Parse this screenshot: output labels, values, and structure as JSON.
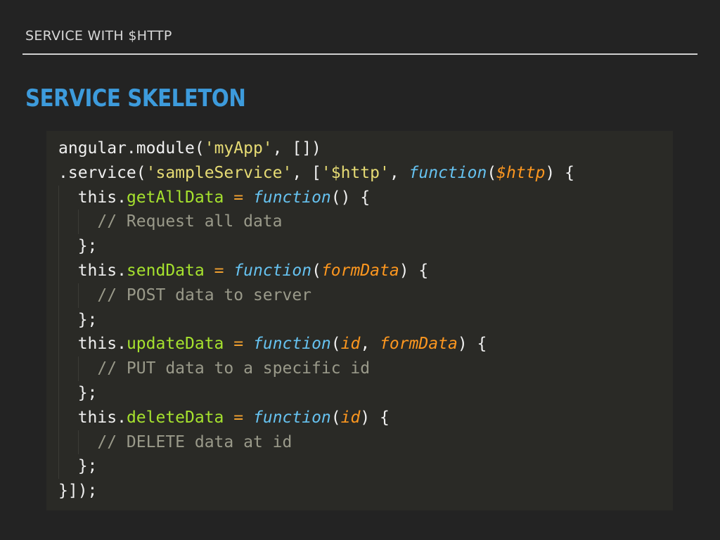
{
  "slide": {
    "header": "SERVICE WITH $HTTP",
    "title": "SERVICE SKELETON"
  },
  "colors": {
    "background": "#232323",
    "title": "#3d9bdc",
    "code_background": "#2a2a26",
    "string": "#e6db74",
    "keyword": "#66c2f0",
    "parameter": "#fd971f",
    "method": "#a6e22e",
    "comment": "#9a9a8a"
  },
  "code": {
    "language": "javascript",
    "lines": [
      [
        [
          "plain",
          "angular.module("
        ],
        [
          "str",
          "'myApp'"
        ],
        [
          "plain",
          ", [])"
        ]
      ],
      [
        [
          "plain",
          ".service("
        ],
        [
          "str",
          "'sampleService'"
        ],
        [
          "plain",
          ", ["
        ],
        [
          "str",
          "'$http'"
        ],
        [
          "plain",
          ", "
        ],
        [
          "kw",
          "function"
        ],
        [
          "plain",
          "("
        ],
        [
          "param",
          "$http"
        ],
        [
          "plain",
          ") {"
        ]
      ],
      [
        [
          "plain",
          "  this."
        ],
        [
          "method",
          "getAllData"
        ],
        [
          "plain",
          " "
        ],
        [
          "eq",
          "="
        ],
        [
          "plain",
          " "
        ],
        [
          "kw",
          "function"
        ],
        [
          "plain",
          "() {"
        ]
      ],
      [
        [
          "plain",
          "    "
        ],
        [
          "cm",
          "// Request all data"
        ]
      ],
      [
        [
          "plain",
          "  };"
        ]
      ],
      [
        [
          "plain",
          "  this."
        ],
        [
          "method",
          "sendData"
        ],
        [
          "plain",
          " "
        ],
        [
          "eq",
          "="
        ],
        [
          "plain",
          " "
        ],
        [
          "kw",
          "function"
        ],
        [
          "plain",
          "("
        ],
        [
          "param",
          "formData"
        ],
        [
          "plain",
          ") {"
        ]
      ],
      [
        [
          "plain",
          "    "
        ],
        [
          "cm",
          "// POST data to server"
        ]
      ],
      [
        [
          "plain",
          "  };"
        ]
      ],
      [
        [
          "plain",
          "  this."
        ],
        [
          "method",
          "updateData"
        ],
        [
          "plain",
          " "
        ],
        [
          "eq",
          "="
        ],
        [
          "plain",
          " "
        ],
        [
          "kw",
          "function"
        ],
        [
          "plain",
          "("
        ],
        [
          "param",
          "id"
        ],
        [
          "plain",
          ", "
        ],
        [
          "param",
          "formData"
        ],
        [
          "plain",
          ") {"
        ]
      ],
      [
        [
          "plain",
          "    "
        ],
        [
          "cm",
          "// PUT data to a specific id"
        ]
      ],
      [
        [
          "plain",
          "  };"
        ]
      ],
      [
        [
          "plain",
          "  this."
        ],
        [
          "method",
          "deleteData"
        ],
        [
          "plain",
          " "
        ],
        [
          "eq",
          "="
        ],
        [
          "plain",
          " "
        ],
        [
          "kw",
          "function"
        ],
        [
          "plain",
          "("
        ],
        [
          "param",
          "id"
        ],
        [
          "plain",
          ") {"
        ]
      ],
      [
        [
          "plain",
          "    "
        ],
        [
          "cm",
          "// DELETE data at id"
        ]
      ],
      [
        [
          "plain",
          "  };"
        ]
      ],
      [
        [
          "plain",
          "}]);"
        ]
      ]
    ]
  }
}
